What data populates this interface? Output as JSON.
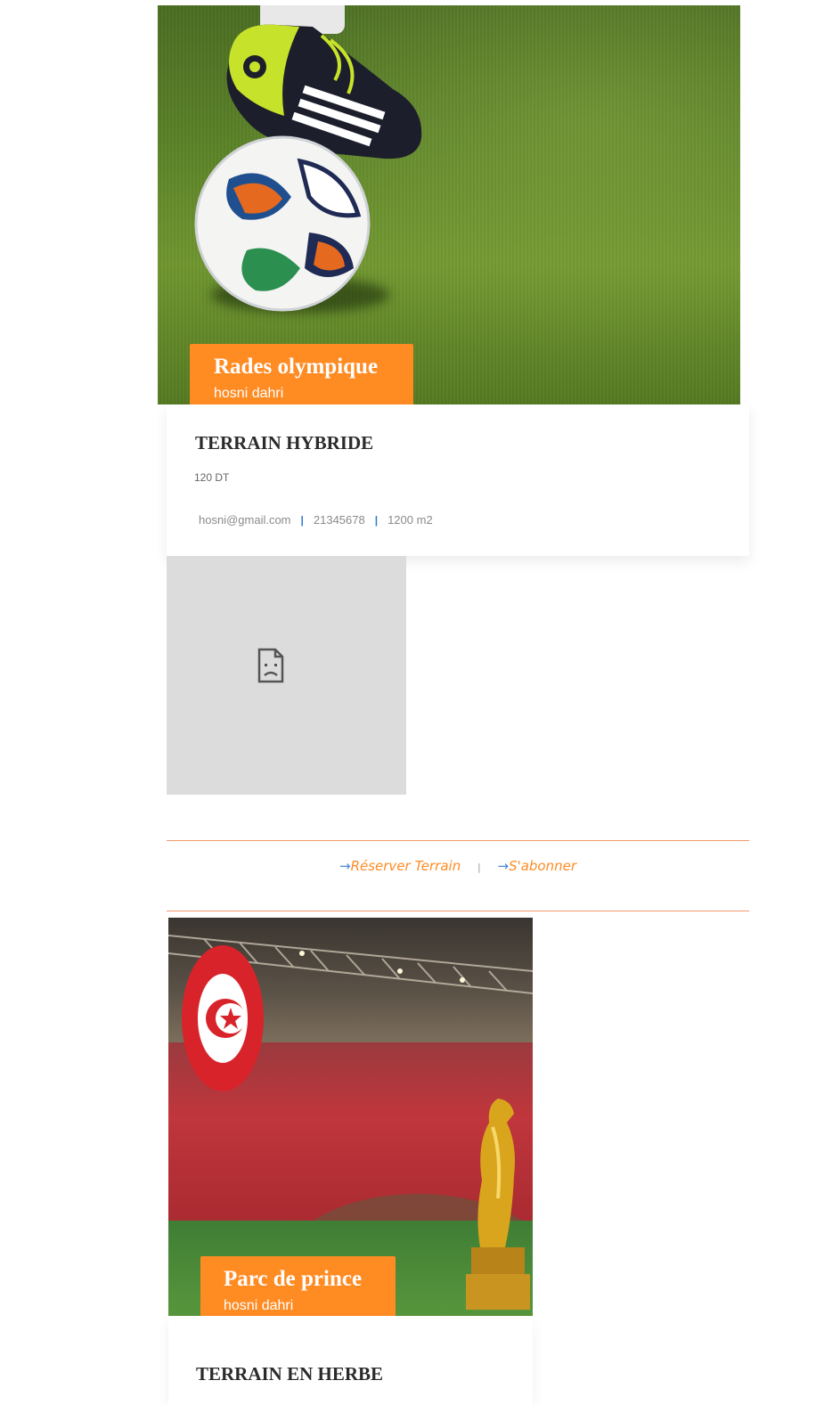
{
  "cards": [
    {
      "name": "Rades olympique",
      "owner": "hosni dahri",
      "type": "TERRAIN HYBRIDE",
      "price": "120 DT",
      "email": "hosni@gmail.com",
      "phone": "21345678",
      "area": "1200 m2",
      "image": "football-boot-ball-on-grass"
    },
    {
      "name": "Parc de prince",
      "owner": "hosni dahri",
      "type": "TERRAIN EN HERBE",
      "image": "stadium-tunisia-flag-trophy"
    }
  ],
  "media_placeholder": {
    "icon": "broken-image-icon"
  },
  "actions": {
    "reserve_label": "Réserver Terrain",
    "subscribe_label": "S'abonner",
    "arrow_icon": "arrow-right-icon",
    "separator": "|"
  },
  "meta_separator": "|",
  "colors": {
    "accent": "#ff8b23",
    "divider": "#f19a6a",
    "separator": "#2f7bd0"
  }
}
